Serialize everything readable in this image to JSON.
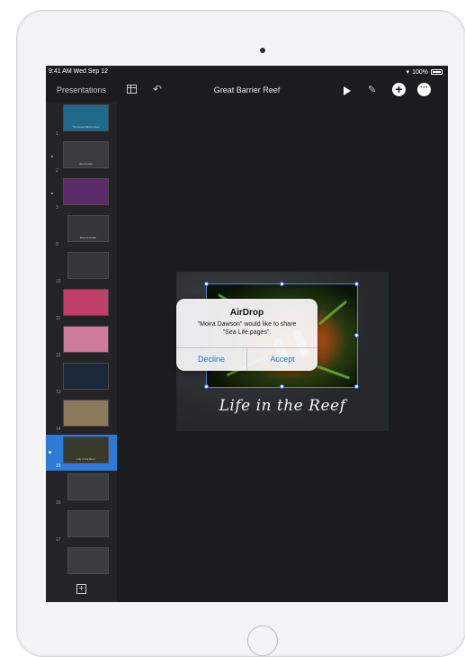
{
  "status": {
    "time": "9:41 AM  Wed Sep 12",
    "battery": "100%"
  },
  "toolbar": {
    "presentations_label": "Presentations",
    "doc_title": "Great Barrier Reef"
  },
  "navigator": {
    "slides": [
      {
        "num": "1",
        "caption": "The Great Barrier Reef",
        "state": "normal",
        "indent": false,
        "bg": "#1f6a8a"
      },
      {
        "num": "2",
        "caption": "Reef Facts",
        "state": "collapsed",
        "indent": false,
        "bg": "#3a3c40"
      },
      {
        "num": "3",
        "caption": "",
        "state": "collapsed",
        "indent": false,
        "bg": "#5a2a6a"
      },
      {
        "num": "9",
        "caption": "Reef Animals",
        "state": "normal",
        "indent": true,
        "bg": "#34363a"
      },
      {
        "num": "10",
        "caption": "",
        "state": "normal",
        "indent": true,
        "bg": "#34363a"
      },
      {
        "num": "11",
        "caption": "",
        "state": "normal",
        "indent": false,
        "bg": "#c0406a"
      },
      {
        "num": "12",
        "caption": "",
        "state": "normal",
        "indent": false,
        "bg": "#d07a9a"
      },
      {
        "num": "13",
        "caption": "",
        "state": "normal",
        "indent": false,
        "bg": "#1a2a3a"
      },
      {
        "num": "14",
        "caption": "",
        "state": "normal",
        "indent": false,
        "bg": "#8a7a5a"
      },
      {
        "num": "15",
        "caption": "Life in the Reef",
        "state": "selected",
        "indent": false,
        "bg": "#3a3a2a"
      },
      {
        "num": "16",
        "caption": "",
        "state": "normal",
        "indent": true,
        "bg": "#3a3c40"
      },
      {
        "num": "17",
        "caption": "",
        "state": "normal",
        "indent": true,
        "bg": "#3a3c40"
      },
      {
        "num": "",
        "caption": "",
        "state": "normal",
        "indent": true,
        "bg": "#3a3c40"
      }
    ]
  },
  "slide": {
    "title": "Life in the Reef"
  },
  "alert": {
    "title": "AirDrop",
    "message_line1": "\"Moira Dawson\" would like to share",
    "message_line2": "\"Sea Life.pages\".",
    "decline_label": "Decline",
    "accept_label": "Accept"
  },
  "colors": {
    "accent": "#1a78e6",
    "selection": "#2d7bd6",
    "toolbar_bg": "#1c1c1e"
  }
}
